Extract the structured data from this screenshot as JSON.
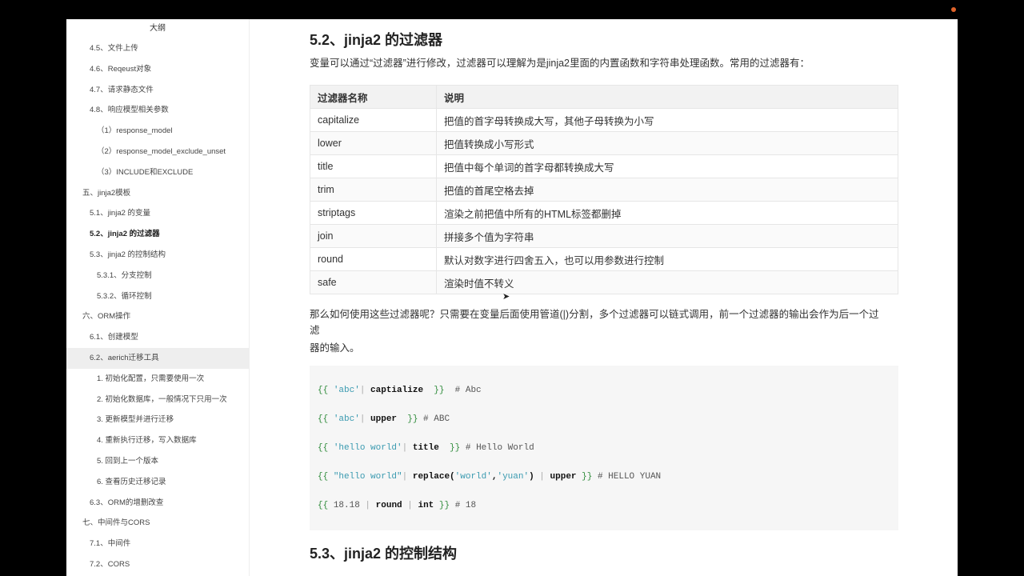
{
  "sidebar": {
    "title": "大纲",
    "items": [
      {
        "label": "4.5、文件上传",
        "level": 1
      },
      {
        "label": "4.6、Reqeust对象",
        "level": 1
      },
      {
        "label": "4.7、请求静态文件",
        "level": 1
      },
      {
        "label": "4.8、响应模型相关参数",
        "level": 1
      },
      {
        "label": "（1）response_model",
        "level": 3
      },
      {
        "label": "（2）response_model_exclude_unset",
        "level": 3
      },
      {
        "label": "（3）INCLUDE和EXCLUDE",
        "level": 3
      },
      {
        "label": "五、jinja2模板",
        "level": 0
      },
      {
        "label": "5.1、jinja2 的变量",
        "level": 1
      },
      {
        "label": "5.2、jinja2 的过滤器",
        "level": 1,
        "active": true
      },
      {
        "label": "5.3、jinja2 的控制结构",
        "level": 1
      },
      {
        "label": "5.3.1、分支控制",
        "level": 2
      },
      {
        "label": "5.3.2、循环控制",
        "level": 2
      },
      {
        "label": "六、ORM操作",
        "level": 0
      },
      {
        "label": "6.1、创建模型",
        "level": 1
      },
      {
        "label": "6.2、aerich迁移工具",
        "level": 1,
        "hover": true
      },
      {
        "label": "1. 初始化配置，只需要使用一次",
        "level": 2
      },
      {
        "label": "2. 初始化数据库，一般情况下只用一次",
        "level": 2
      },
      {
        "label": "3. 更新模型并进行迁移",
        "level": 2
      },
      {
        "label": "4. 重新执行迁移，写入数据库",
        "level": 2
      },
      {
        "label": "5. 回到上一个版本",
        "level": 2
      },
      {
        "label": "6. 查看历史迁移记录",
        "level": 2
      },
      {
        "label": "6.3、ORM的增删改查",
        "level": 1
      },
      {
        "label": "七、中间件与CORS",
        "level": 0
      },
      {
        "label": "7.1、中间件",
        "level": 1
      },
      {
        "label": "7.2、CORS",
        "level": 1
      }
    ]
  },
  "main": {
    "heading": "5.2、jinja2 的过滤器",
    "intro": "变量可以通过“过滤器”进行修改，过滤器可以理解为是jinja2里面的内置函数和字符串处理函数。常用的过滤器有：",
    "table": {
      "headers": [
        "过滤器名称",
        "说明"
      ],
      "rows": [
        [
          "capitalize",
          "把值的首字母转换成大写，其他子母转换为小写"
        ],
        [
          "lower",
          "把值转换成小写形式"
        ],
        [
          "title",
          "把值中每个单词的首字母都转换成大写"
        ],
        [
          "trim",
          "把值的首尾空格去掉"
        ],
        [
          "striptags",
          "渲染之前把值中所有的HTML标签都删掉"
        ],
        [
          "join",
          "拼接多个值为字符串"
        ],
        [
          "round",
          "默认对数字进行四舍五入，也可以用参数进行控制"
        ],
        [
          "safe",
          "渲染时值不转义"
        ]
      ]
    },
    "usage": [
      "那么如何使用这些过滤器呢？只需要在变量后面使用管道(|)分割，多个过滤器可以链式调用，前一个过滤器的输出会作为后一个过",
      "滤",
      "器的输入。"
    ],
    "code": [
      [
        [
          "b",
          "{{ "
        ],
        [
          "s",
          "'abc'"
        ],
        [
          "pi",
          "| "
        ],
        [
          "k",
          "captialize"
        ],
        [
          "b",
          "  }}"
        ],
        [
          "c",
          "  # Abc"
        ]
      ],
      [
        [
          "b",
          "{{ "
        ],
        [
          "s",
          "'abc'"
        ],
        [
          "pi",
          "| "
        ],
        [
          "k",
          "upper"
        ],
        [
          "b",
          "  }}"
        ],
        [
          "c",
          " # ABC"
        ]
      ],
      [
        [
          "b",
          "{{ "
        ],
        [
          "s",
          "'hello world'"
        ],
        [
          "pi",
          "| "
        ],
        [
          "k",
          "title"
        ],
        [
          "b",
          "  }}"
        ],
        [
          "c",
          " # Hello World"
        ]
      ],
      [
        [
          "b",
          "{{ "
        ],
        [
          "s",
          "\"hello world\""
        ],
        [
          "pi",
          "| "
        ],
        [
          "k",
          "replace("
        ],
        [
          "s",
          "'world'"
        ],
        [
          "k",
          ","
        ],
        [
          "s",
          "'yuan'"
        ],
        [
          "k",
          ")"
        ],
        [
          "pi",
          " | "
        ],
        [
          "k",
          "upper"
        ],
        [
          "b",
          " }}"
        ],
        [
          "c",
          " # HELLO YUAN"
        ]
      ],
      [
        [
          "b",
          "{{ "
        ],
        [
          "n",
          "18.18"
        ],
        [
          "pi",
          " | "
        ],
        [
          "k",
          "round"
        ],
        [
          "pi",
          " | "
        ],
        [
          "k",
          "int"
        ],
        [
          "b",
          " }}"
        ],
        [
          "c",
          " # 18"
        ]
      ]
    ],
    "next_heading": "5.3、jinja2 的控制结构"
  }
}
